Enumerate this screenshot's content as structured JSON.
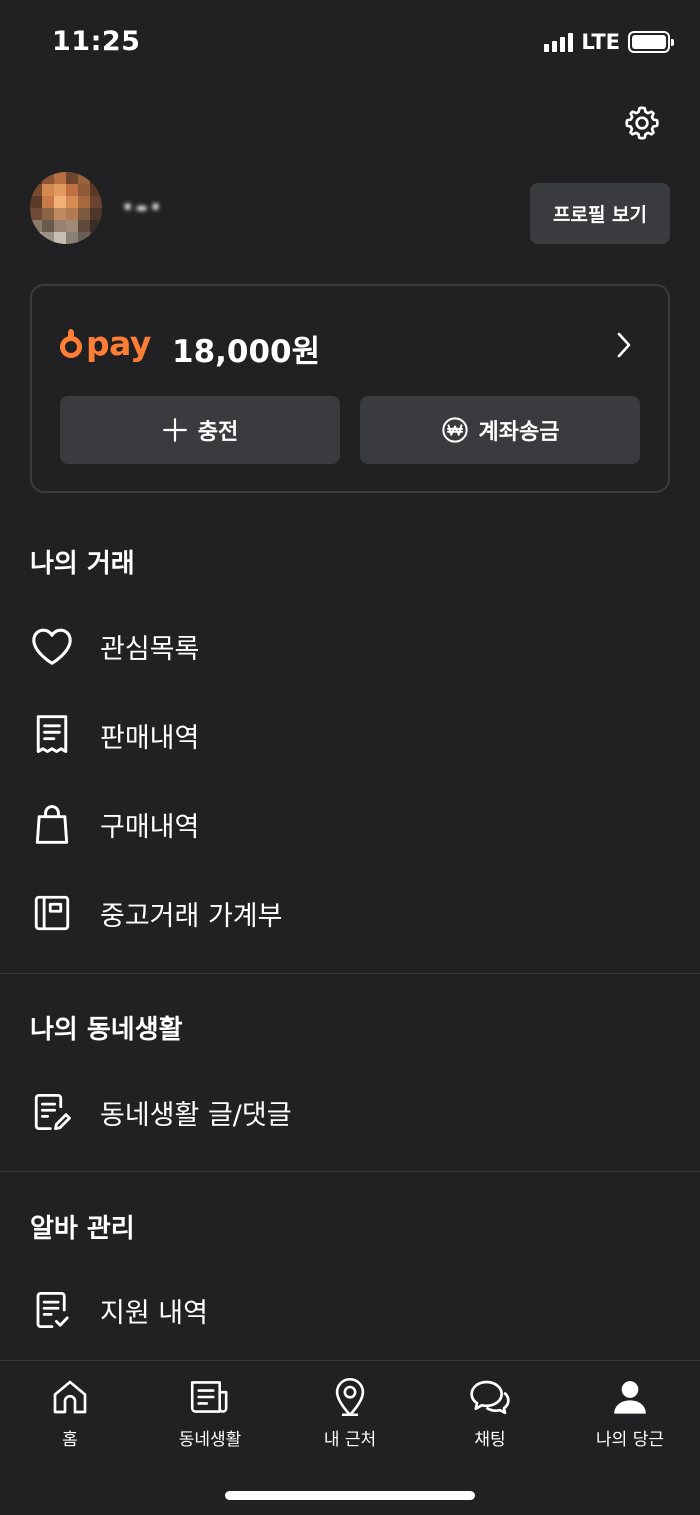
{
  "status_bar": {
    "time": "11:25",
    "network": "LTE",
    "battery_level": 1.0,
    "signal_bars": 4
  },
  "header": {
    "settings_icon": "gear-icon"
  },
  "profile": {
    "nickname": "·-·",
    "view_profile_label": "프로필 보기",
    "avatar_icon": "avatar"
  },
  "pay": {
    "logo": "pay",
    "balance": "18,000원",
    "charge_label": "충전",
    "transfer_label": "계좌송금",
    "accent_color": "#ff7e36"
  },
  "sections": {
    "trade": {
      "title": "나의 거래",
      "items": [
        {
          "label": "관심목록",
          "icon": "heart-icon"
        },
        {
          "label": "판매내역",
          "icon": "receipt-icon"
        },
        {
          "label": "구매내역",
          "icon": "shopping-bag-icon"
        },
        {
          "label": "중고거래 가계부",
          "icon": "ledger-book-icon"
        }
      ]
    },
    "neighborhood": {
      "title": "나의 동네생활",
      "items": [
        {
          "label": "동네생활 글/댓글",
          "icon": "document-edit-icon"
        }
      ]
    },
    "jobs": {
      "title": "알바 관리",
      "items": [
        {
          "label": "지원 내역",
          "icon": "document-check-icon"
        }
      ]
    }
  },
  "tab_bar": {
    "tabs": [
      {
        "label": "홈",
        "icon": "home-icon"
      },
      {
        "label": "동네생활",
        "icon": "newspaper-icon"
      },
      {
        "label": "내 근처",
        "icon": "location-pin-icon"
      },
      {
        "label": "채팅",
        "icon": "chat-bubbles-icon"
      },
      {
        "label": "나의 당근",
        "icon": "user-icon",
        "active": true
      }
    ]
  }
}
